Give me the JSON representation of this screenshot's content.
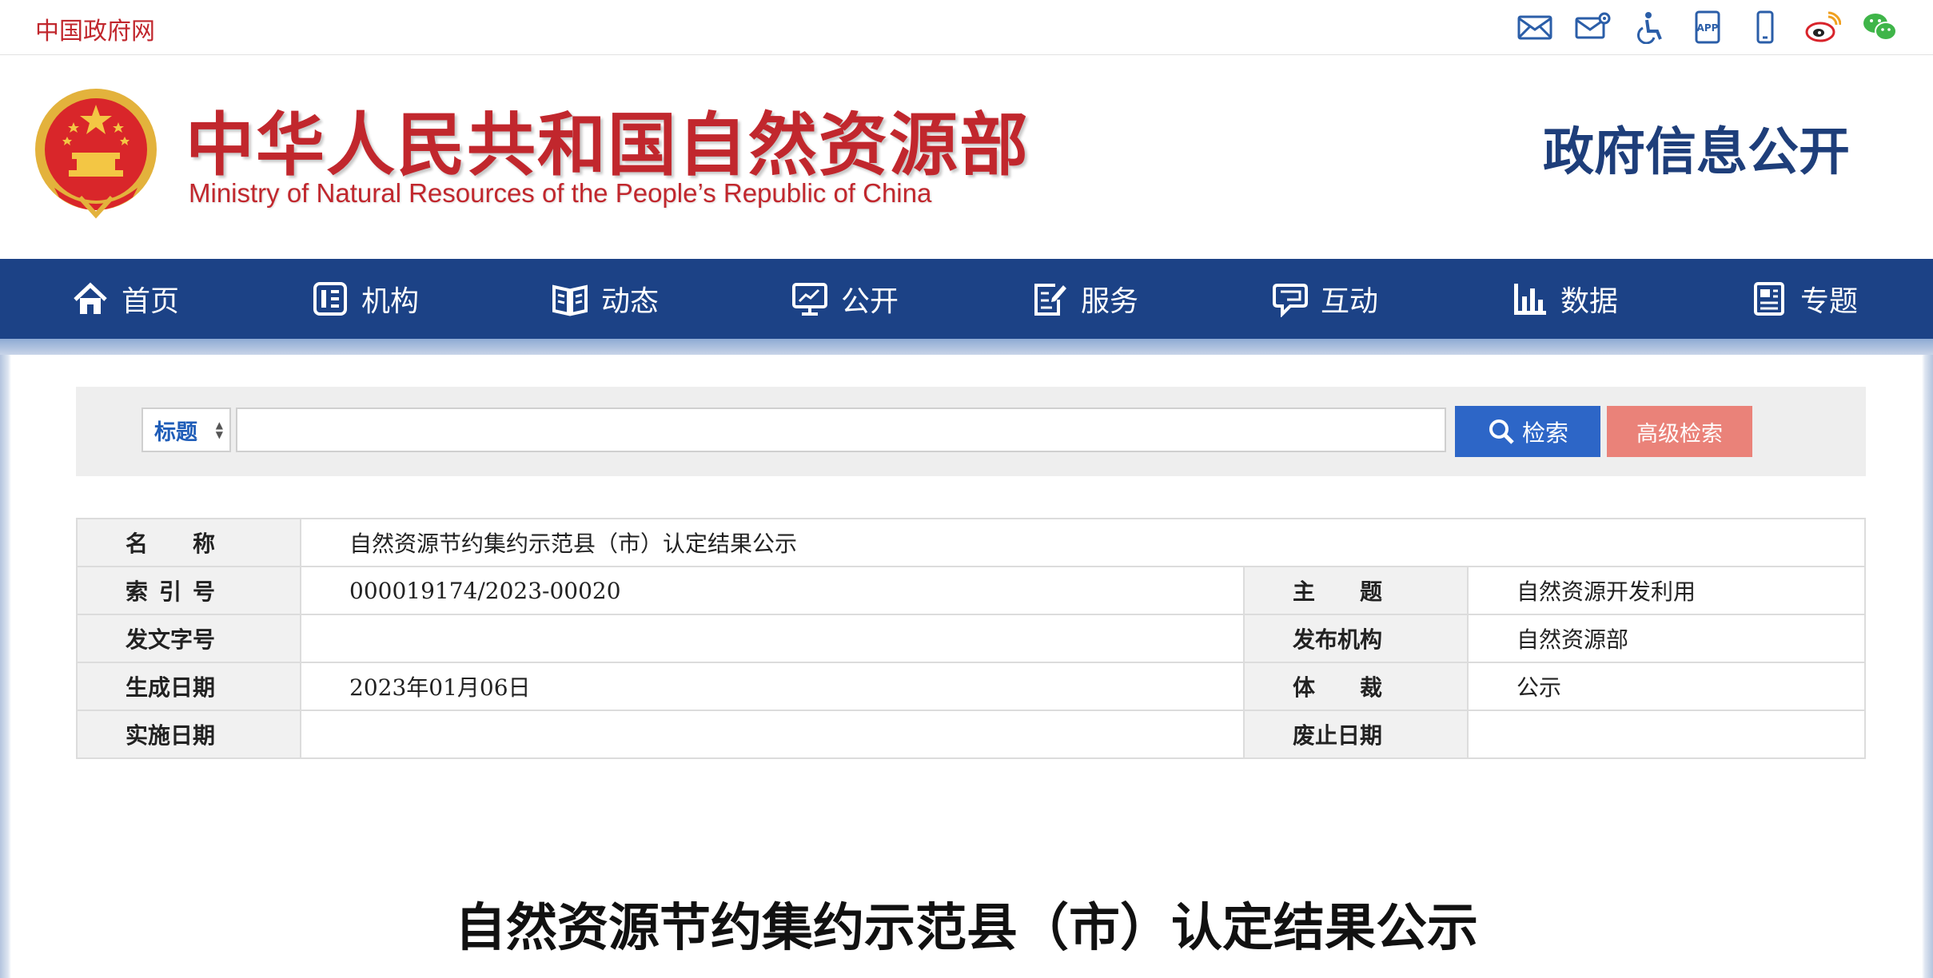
{
  "top_bar": {
    "gov_link": "中国政府网",
    "icons": [
      "mail-icon",
      "mail-settings-icon",
      "accessibility-icon",
      "app-icon",
      "mobile-icon",
      "weibo-icon",
      "wechat-icon"
    ],
    "app_label": "APP"
  },
  "header": {
    "ministry_cn": "中华人民共和国自然资源部",
    "ministry_en": "Ministry of Natural Resources of the People’s Republic of China",
    "section_title": "政府信息公开"
  },
  "nav": {
    "items": [
      {
        "label": "首页",
        "icon": "home-icon"
      },
      {
        "label": "机构",
        "icon": "organization-icon"
      },
      {
        "label": "动态",
        "icon": "book-icon"
      },
      {
        "label": "公开",
        "icon": "monitor-icon"
      },
      {
        "label": "服务",
        "icon": "edit-icon"
      },
      {
        "label": "互动",
        "icon": "chat-icon"
      },
      {
        "label": "数据",
        "icon": "bar-chart-icon"
      },
      {
        "label": "专题",
        "icon": "newspaper-icon"
      }
    ]
  },
  "search": {
    "type_selected": "标题",
    "input_value": "",
    "search_label": "检索",
    "advanced_label": "高级检索"
  },
  "meta": {
    "name_label": "名称",
    "name_value": "自然资源节约集约示范县（市）认定结果公示",
    "index_label": "索引号",
    "index_value": "000019174/2023-00020",
    "topic_label": "主题",
    "topic_value": "自然资源开发利用",
    "doc_no_label": "发文字号",
    "doc_no_value": "",
    "publisher_label": "发布机构",
    "publisher_value": "自然资源部",
    "created_label": "生成日期",
    "created_value": "2023年01月06日",
    "genre_label": "体裁",
    "genre_value": "公示",
    "effective_label": "实施日期",
    "effective_value": "",
    "expiry_label": "废止日期",
    "expiry_value": ""
  },
  "article": {
    "title": "自然资源节约集约示范县（市）认定结果公示"
  },
  "colors": {
    "brand_red": "#c1272d",
    "nav_blue": "#1c4286",
    "search_blue": "#2d66c7",
    "advanced_coral": "#ea8279"
  }
}
